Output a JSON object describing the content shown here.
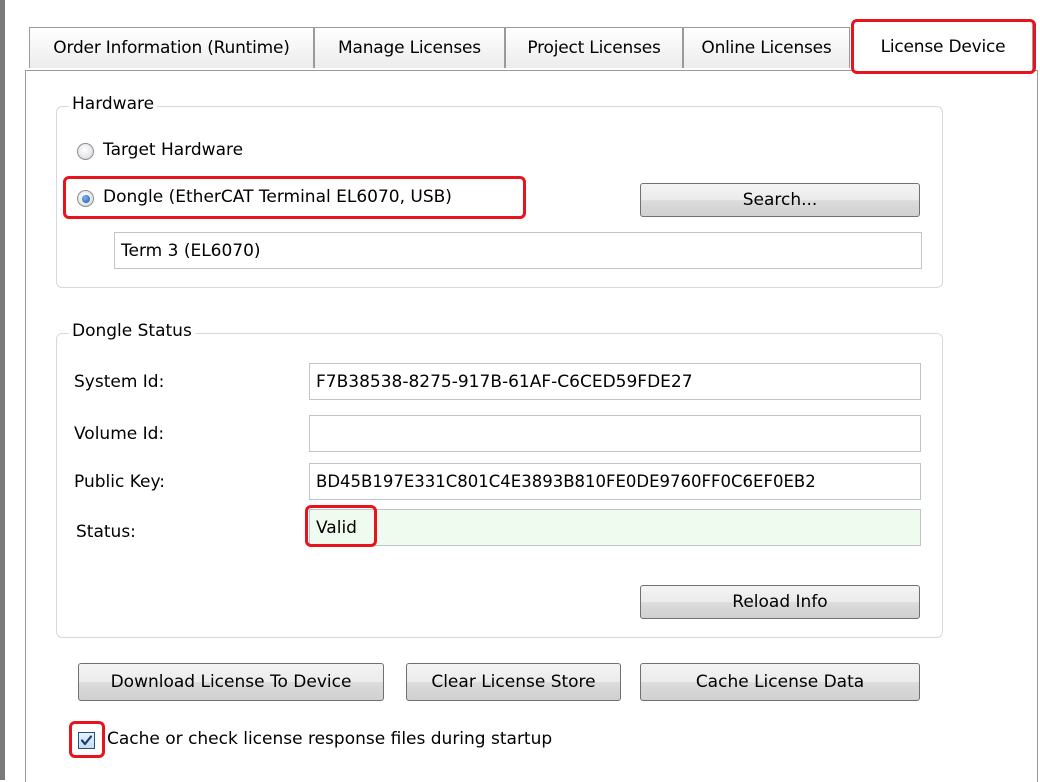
{
  "tabs": [
    {
      "label": "Order Information (Runtime)"
    },
    {
      "label": "Manage Licenses"
    },
    {
      "label": "Project Licenses"
    },
    {
      "label": "Online Licenses"
    },
    {
      "label": "License Device"
    }
  ],
  "hardware": {
    "title": "Hardware",
    "target_label": "Target Hardware",
    "dongle_label": "Dongle (EtherCAT Terminal EL6070, USB)",
    "selected": "dongle",
    "search_button": "Search...",
    "device_value": "Term 3 (EL6070)"
  },
  "dongle_status": {
    "title": "Dongle Status",
    "system_id_label": "System Id:",
    "system_id_value": "F7B38538-8275-917B-61AF-C6CED59FDE27",
    "volume_id_label": "Volume Id:",
    "volume_id_value": "",
    "public_key_label": "Public Key:",
    "public_key_value": "BD45B197E331C801C4E3893B810FE0DE9760FF0C6EF0EB2",
    "status_label": "Status:",
    "status_value": "Valid",
    "reload_button": "Reload Info"
  },
  "actions": {
    "download_button": "Download License To Device",
    "clear_button": "Clear License Store",
    "cache_button": "Cache License Data"
  },
  "startup_checkbox": {
    "label": "Cache or check license response files during startup",
    "checked": true
  },
  "colors": {
    "highlight": "#e8141b",
    "valid_field_bg": "#eefbee"
  }
}
